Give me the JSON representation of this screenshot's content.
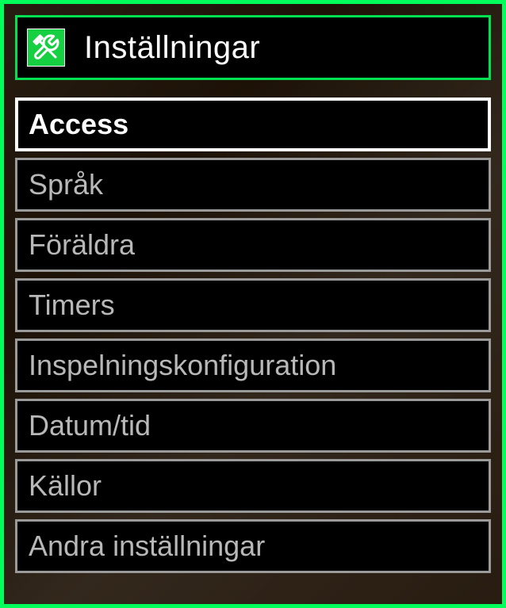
{
  "header": {
    "title": "Inställningar",
    "icon": "tools-icon"
  },
  "menu": {
    "items": [
      {
        "label": "Access",
        "selected": true
      },
      {
        "label": "Språk",
        "selected": false
      },
      {
        "label": "Föräldra",
        "selected": false
      },
      {
        "label": "Timers",
        "selected": false
      },
      {
        "label": "Inspelningskonfiguration",
        "selected": false
      },
      {
        "label": "Datum/tid",
        "selected": false
      },
      {
        "label": "Källor",
        "selected": false
      },
      {
        "label": "Andra inställningar",
        "selected": false
      }
    ]
  },
  "colors": {
    "accent": "#00ff5a",
    "iconBg": "#15d040",
    "borderNormal": "#9a9a9a",
    "borderSelected": "#ffffff",
    "textNormal": "#b8b8b8",
    "textSelected": "#ffffff"
  }
}
